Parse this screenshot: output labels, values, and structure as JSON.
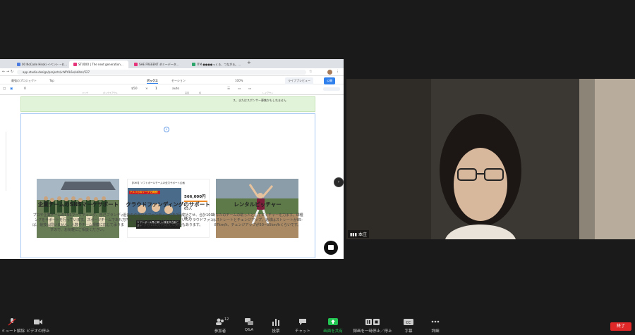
{
  "browser": {
    "tabs": [
      {
        "label": "00 NoCode Hiroki イベント・セ…",
        "color": "#4a7be0"
      },
      {
        "label": "STUDIO | The next generation…",
        "color": "#e6357a"
      },
      {
        "label": "SHE FREEENT ダミーデータ…",
        "color": "#e6357a"
      },
      {
        "label": "ITM ●●●●っくる、つながる。…",
        "color": "#2ca56a"
      }
    ],
    "url": "app.studio.design/projects/vrWYlL6e/editor/527",
    "project_name": "最強のプロジェクト",
    "page_select": "Top",
    "panel_tabs": [
      "ボックス",
      "セーション"
    ],
    "zoom_value": "100%",
    "live_preview": "ライブプレビュー",
    "publish": "公開",
    "tool_labels": [
      "リンク",
      "ボックスアウト",
      "画面",
      "横",
      "縦",
      "レイアウト"
    ],
    "tool_numbers": [
      "0",
      "$50",
      "1",
      "auto"
    ]
  },
  "page": {
    "green_text": "ス、またはスポンサー募集かもしれません",
    "columns": [
      {
        "title": "企業チームのSNSマーケサポート",
        "body": "プロや企業チームのSNSマーケティング、自己ブランディングをサポートを行っています。スポーツチームであれば、競技は問いません。人数やチーム規模に応じて承りますので、お気軽にご相談ください。"
      },
      {
        "title": "クラウドファンディングのサポート",
        "body": "過去のクラウドファンディングを2回成功させ、合計100万円以上調達。アドバイスせていんだいたクラウドファンディングが100万円達えた実績もあります。"
      },
      {
        "title": "レンタルピッチャー",
        "body": "あなたのチームの助っ人としてピッチャーを力ます。球種はストレートとチェンジアップ。速球はストレートが85-87km/h、チェンジアップが50~55km/hくらいです。"
      }
    ],
    "crowdfunding_card": {
      "banner": "【SHE】ソフトボールチームの全力サポート企画",
      "amount": "566,000円",
      "supporters": "65人",
      "days_left": "終了",
      "poster_top": "アメリカのリーグで挑戦！",
      "poster_bottom": "ソフトボール界に新しい風を吹き起こす！"
    }
  },
  "video": {
    "participant_name": "本庄"
  },
  "zoom_toolbar": {
    "items": [
      {
        "label": "ミュート解除",
        "icon": "microphone-icon"
      },
      {
        "label": "ビデオの停止",
        "icon": "camera-icon"
      },
      {
        "label": "参加者",
        "icon": "participants-icon",
        "badge": "12"
      },
      {
        "label": "Q&A",
        "icon": "qa-icon"
      },
      {
        "label": "投票",
        "icon": "poll-icon"
      },
      {
        "label": "チャット",
        "icon": "chat-icon"
      },
      {
        "label": "画面を共有",
        "icon": "share-screen-icon"
      },
      {
        "label": "録画を一時停止／停止",
        "icon": "record-pause-icon"
      },
      {
        "label": "字幕",
        "icon": "cc-icon"
      },
      {
        "label": "詳細",
        "icon": "more-icon"
      }
    ],
    "end_label": "終了",
    "accent": "#2d8cff",
    "end_color": "#e02828",
    "share_color": "#23c552"
  }
}
